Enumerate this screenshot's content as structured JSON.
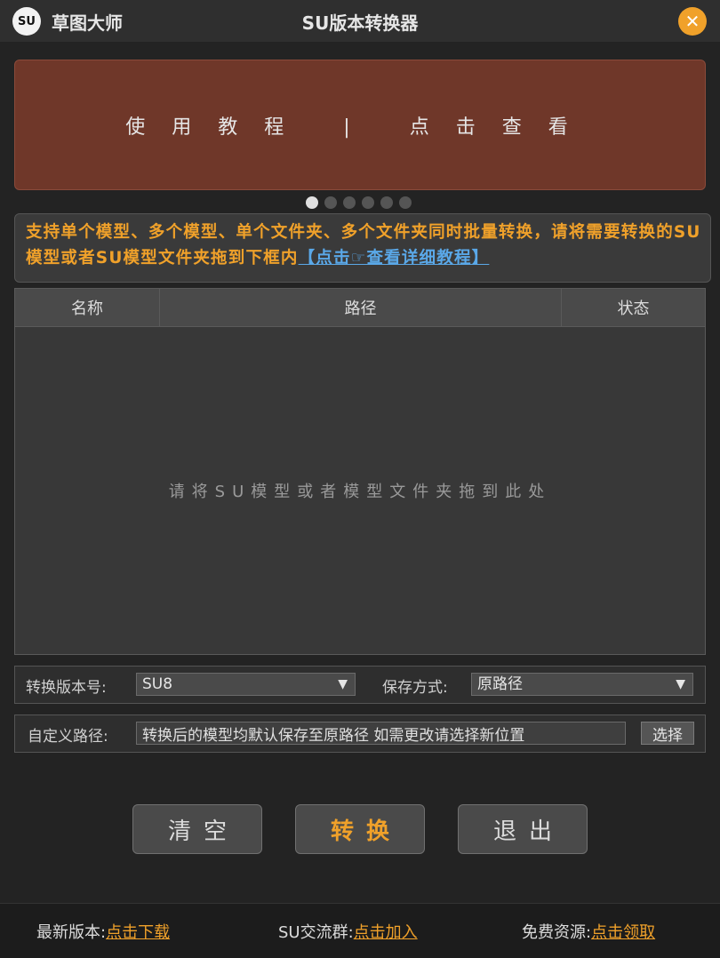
{
  "titlebar": {
    "logo_text": "SU",
    "app_name": "草图大师",
    "title": "SU版本转换器",
    "close_symbol": "✕"
  },
  "banner": {
    "text": "使用教程 | 点击查看"
  },
  "carousel": {
    "count": 6,
    "active": 0
  },
  "notice": {
    "text": "支持单个模型、多个模型、单个文件夹、多个文件夹同时批量转换，请将需要转换的SU模型或者SU模型文件夹拖到下框内",
    "link_text": "【点击☞查看详细教程】"
  },
  "filelist": {
    "columns": [
      "名称",
      "路径",
      "状态"
    ],
    "placeholder": "请将SU模型或者模型文件夹拖到此处"
  },
  "options": {
    "version_label": "转换版本号:",
    "version_value": "SU8",
    "save_label": "保存方式:",
    "save_value": "原路径"
  },
  "custom_path": {
    "label": "自定义路径:",
    "value": "转换后的模型均默认保存至原路径 如需更改请选择新位置",
    "choose_label": "选择"
  },
  "buttons": {
    "clear": "清空",
    "convert": "转换",
    "exit": "退出"
  },
  "footer": {
    "latest_label": "最新版本:",
    "latest_link": "点击下载",
    "group_label": "SU交流群:",
    "group_link": "点击加入",
    "free_label": "免费资源:",
    "free_link": "点击领取"
  },
  "colors": {
    "accent": "#f0a12a",
    "banner": "#6f3729",
    "link_blue": "#5aa8e8"
  }
}
